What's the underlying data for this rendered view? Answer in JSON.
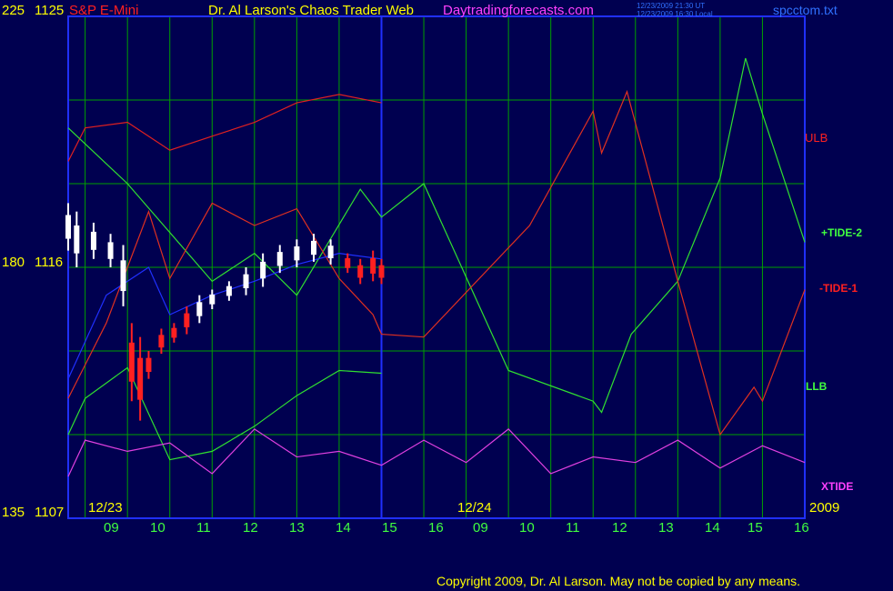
{
  "header": {
    "left_scale_top": "225",
    "right_scale_top": "1125",
    "instrument": "S&P E-Mini",
    "title": "Dr. Al Larson's Chaos Trader Web",
    "website": "Daytradingforecasts.com",
    "timestamp_ut": "12/23/2009 21:30 UT",
    "timestamp_local": "12/23/2009 16:30 Local",
    "filename": "spcctom.txt"
  },
  "scale": {
    "mid_left": "180",
    "mid_right": "1116",
    "bottom_left": "135",
    "bottom_right": "1107"
  },
  "labels": {
    "ulb": "ULB",
    "tide2": "+TIDE-2",
    "tide1": "-TIDE-1",
    "llb": "LLB",
    "xtide": "XTIDE"
  },
  "dates": {
    "day1": "12/23",
    "day2": "12/24",
    "year": "2009"
  },
  "hours": [
    "09",
    "10",
    "11",
    "12",
    "13",
    "14",
    "15",
    "16",
    "09",
    "10",
    "11",
    "12",
    "13",
    "14",
    "15",
    "16"
  ],
  "copyright": "Copyright 2009, Dr. Al Larson. May not be copied by any means.",
  "colors": {
    "background": "#000050",
    "grid": "#00a000",
    "frame": "#2030ff",
    "price_up": "#ffffff",
    "price_down": "#ff2020",
    "ulb_llb": "#e02020",
    "tide_green": "#30e030",
    "tide_red": "#e03020",
    "ma_blue": "#2030ff",
    "xtide": "#e040e0"
  },
  "chart_data": {
    "type": "line",
    "title": "S&P E-Mini",
    "y_left_ticks": [
      225,
      180,
      135
    ],
    "y_right_ticks": [
      1125,
      1116,
      1107
    ],
    "x_labels": [
      "09",
      "10",
      "11",
      "12",
      "13",
      "14",
      "15",
      "16",
      "09",
      "10",
      "11",
      "12",
      "13",
      "14",
      "15",
      "16"
    ],
    "days": [
      "12/23",
      "12/24"
    ],
    "grid": true,
    "series": [
      {
        "name": "ULB",
        "x": [
          8.6,
          9.0,
          10.0,
          11.0,
          12.0,
          13.0,
          14.0,
          15.0,
          16.0
        ],
        "values": [
          1119.8,
          1121.0,
          1121.2,
          1120.2,
          1120.7,
          1121.2,
          1121.9,
          1122.2,
          1121.9
        ]
      },
      {
        "name": "LLB",
        "x": [
          8.6,
          9.0,
          10.0,
          11.0,
          12.0,
          13.0,
          14.0,
          15.0,
          16.0
        ],
        "values": [
          1110.0,
          1111.3,
          1112.4,
          1109.1,
          1109.4,
          1110.3,
          1111.4,
          1112.3,
          1112.2
        ]
      },
      {
        "name": "+TIDE-2",
        "x": [
          8.6,
          10.0,
          12.0,
          13.0,
          14.0,
          15.5,
          16.0,
          17.0,
          19.0,
          21.0,
          21.2,
          21.9,
          23.0,
          24.0,
          24.6,
          25.0,
          26.0
        ],
        "values": [
          1121.0,
          1119.0,
          1115.5,
          1116.5,
          1115.0,
          1118.8,
          1117.8,
          1119.0,
          1112.3,
          1111.2,
          1110.8,
          1113.6,
          1115.5,
          1119.2,
          1123.5,
          1121.5,
          1116.9
        ]
      },
      {
        "name": "-TIDE-1",
        "x": [
          8.6,
          9.5,
          10.5,
          11.0,
          12.0,
          13.0,
          14.0,
          15.0,
          15.8,
          16.0,
          17.0,
          19.5,
          21.0,
          21.2,
          21.8,
          23.0,
          24.0,
          24.8,
          25.0,
          26.0
        ],
        "values": [
          1111.3,
          1114.0,
          1118.0,
          1115.6,
          1118.3,
          1117.5,
          1118.1,
          1115.6,
          1114.3,
          1113.6,
          1113.5,
          1117.5,
          1121.6,
          1120.1,
          1122.3,
          1115.5,
          1110.0,
          1111.7,
          1111.2,
          1115.2
        ]
      },
      {
        "name": "MA",
        "x": [
          8.6,
          9.5,
          10.5,
          11.0,
          12.0,
          13.0,
          14.0,
          15.0,
          16.0
        ],
        "values": [
          1112.0,
          1115.0,
          1116.0,
          1114.3,
          1115.0,
          1115.5,
          1116.1,
          1116.5,
          1116.3
        ]
      },
      {
        "name": "XTIDE",
        "x": [
          8.6,
          9.0,
          10.0,
          11.0,
          12.0,
          13.0,
          14.0,
          15.0,
          16.0,
          17.0,
          18.0,
          19.0,
          20.0,
          21.0,
          22.0,
          23.0,
          24.0,
          25.0,
          26.0
        ],
        "values": [
          1108.5,
          1109.8,
          1109.4,
          1109.7,
          1108.6,
          1110.2,
          1109.2,
          1109.4,
          1108.9,
          1109.8,
          1109.0,
          1110.2,
          1108.6,
          1109.2,
          1109.0,
          1109.8,
          1108.8,
          1109.6,
          1109.0
        ]
      }
    ],
    "price_bars": [
      {
        "x": 8.6,
        "high": 1118.3,
        "low": 1116.6,
        "color": "white"
      },
      {
        "x": 8.8,
        "high": 1118.0,
        "low": 1116.0,
        "color": "white"
      },
      {
        "x": 9.2,
        "high": 1117.6,
        "low": 1116.3,
        "color": "white"
      },
      {
        "x": 9.6,
        "high": 1117.2,
        "low": 1116.0,
        "color": "white"
      },
      {
        "x": 9.9,
        "high": 1116.8,
        "low": 1114.6,
        "color": "white"
      },
      {
        "x": 10.1,
        "high": 1114.0,
        "low": 1111.2,
        "color": "red"
      },
      {
        "x": 10.3,
        "high": 1113.5,
        "low": 1110.5,
        "color": "red"
      },
      {
        "x": 10.5,
        "high": 1113.0,
        "low": 1112.0,
        "color": "red"
      },
      {
        "x": 10.8,
        "high": 1113.8,
        "low": 1112.9,
        "color": "red"
      },
      {
        "x": 11.1,
        "high": 1114.0,
        "low": 1113.3,
        "color": "red"
      },
      {
        "x": 11.4,
        "high": 1114.6,
        "low": 1113.6,
        "color": "red"
      },
      {
        "x": 11.7,
        "high": 1115.0,
        "low": 1114.0,
        "color": "white"
      },
      {
        "x": 12.0,
        "high": 1115.2,
        "low": 1114.5,
        "color": "white"
      },
      {
        "x": 12.4,
        "high": 1115.5,
        "low": 1114.8,
        "color": "white"
      },
      {
        "x": 12.8,
        "high": 1116.0,
        "low": 1115.0,
        "color": "white"
      },
      {
        "x": 13.2,
        "high": 1116.5,
        "low": 1115.3,
        "color": "white"
      },
      {
        "x": 13.6,
        "high": 1116.8,
        "low": 1115.8,
        "color": "white"
      },
      {
        "x": 14.0,
        "high": 1117.0,
        "low": 1116.0,
        "color": "white"
      },
      {
        "x": 14.4,
        "high": 1117.2,
        "low": 1116.2,
        "color": "white"
      },
      {
        "x": 14.8,
        "high": 1117.0,
        "low": 1116.1,
        "color": "white"
      },
      {
        "x": 15.2,
        "high": 1116.5,
        "low": 1115.8,
        "color": "red"
      },
      {
        "x": 15.5,
        "high": 1116.3,
        "low": 1115.4,
        "color": "red"
      },
      {
        "x": 15.8,
        "high": 1116.6,
        "low": 1115.5,
        "color": "red"
      },
      {
        "x": 16.0,
        "high": 1116.3,
        "low": 1115.4,
        "color": "red"
      }
    ]
  }
}
